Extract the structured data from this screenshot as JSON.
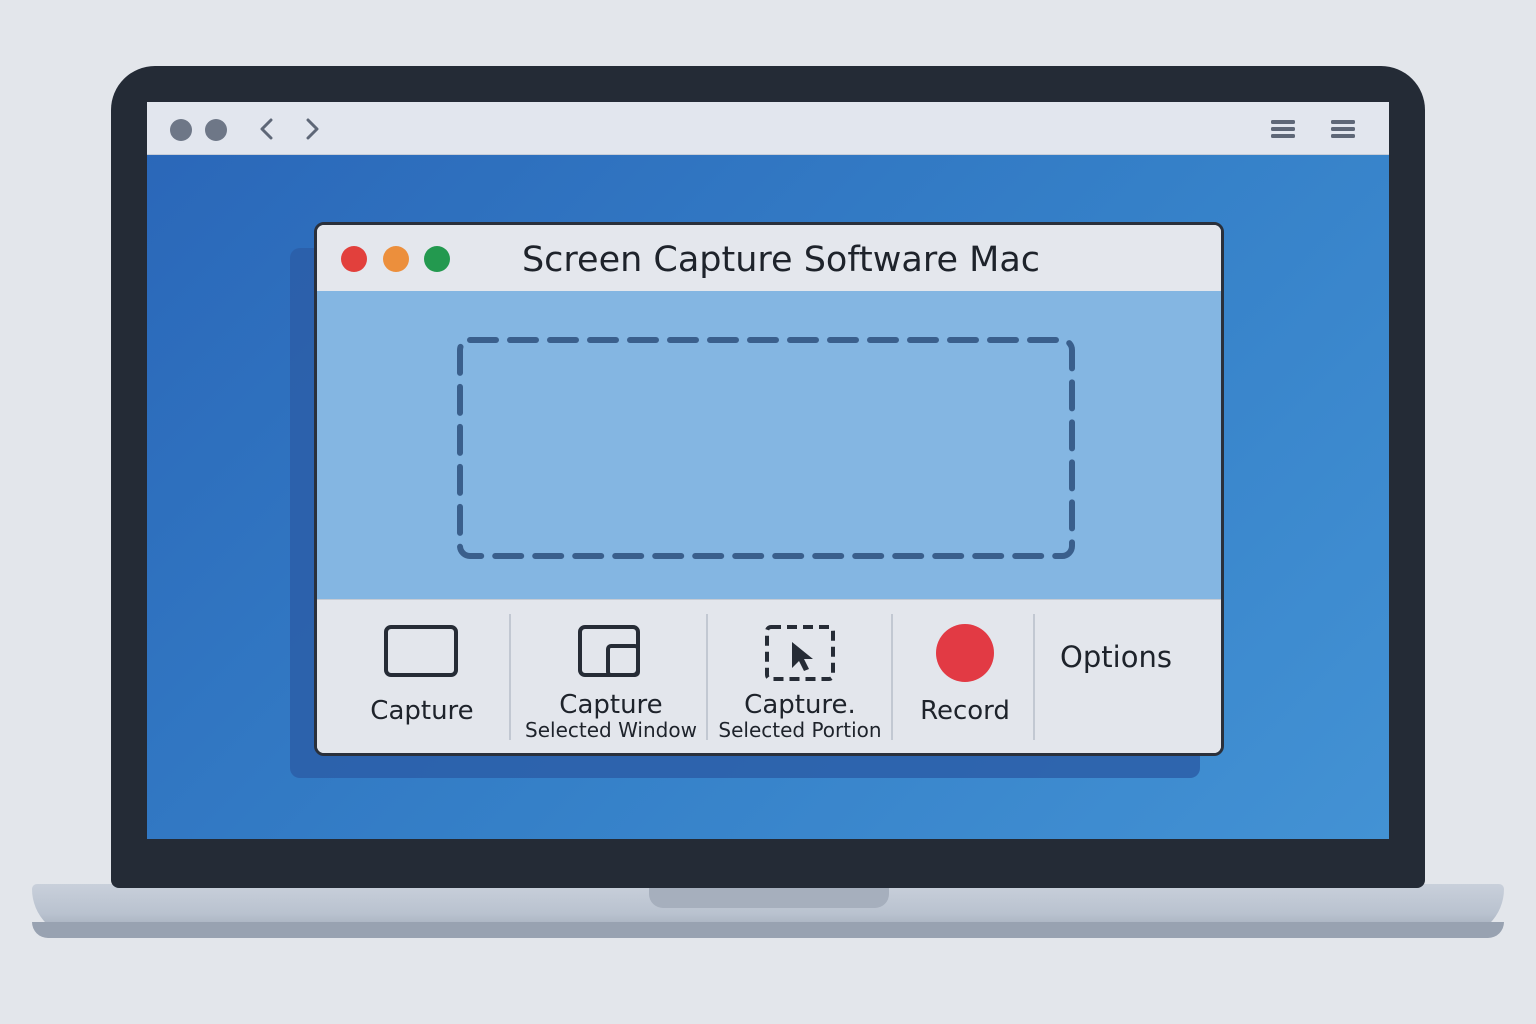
{
  "browser": {
    "window_controls": [
      "dot-icon",
      "dot-icon"
    ],
    "nav": [
      "chevron-left-icon",
      "chevron-right-icon"
    ],
    "menus": [
      "menu-icon",
      "menu-icon"
    ]
  },
  "app": {
    "title": "Screen Capture Software Mac",
    "traffic_lights": {
      "close": "#e2403c",
      "minimize": "#ec8f3c",
      "zoom": "#23994f"
    }
  },
  "toolbar": {
    "capture": {
      "label": "Capture",
      "icon": "screen-icon"
    },
    "capture_window": {
      "label": "Capture",
      "sublabel": "Selected Window",
      "icon": "window-icon"
    },
    "capture_portion": {
      "label": "Capture.",
      "sublabel": "Selected Portion",
      "icon": "selection-cursor-icon"
    },
    "record": {
      "label": "Record",
      "icon": "record-icon",
      "color": "#e23a44"
    },
    "options": {
      "label": "Options"
    }
  },
  "colors": {
    "screen": "#2f74c0",
    "content": "#84b6e2",
    "toolbar": "#e3e6ec",
    "bezel": "#242b36"
  }
}
